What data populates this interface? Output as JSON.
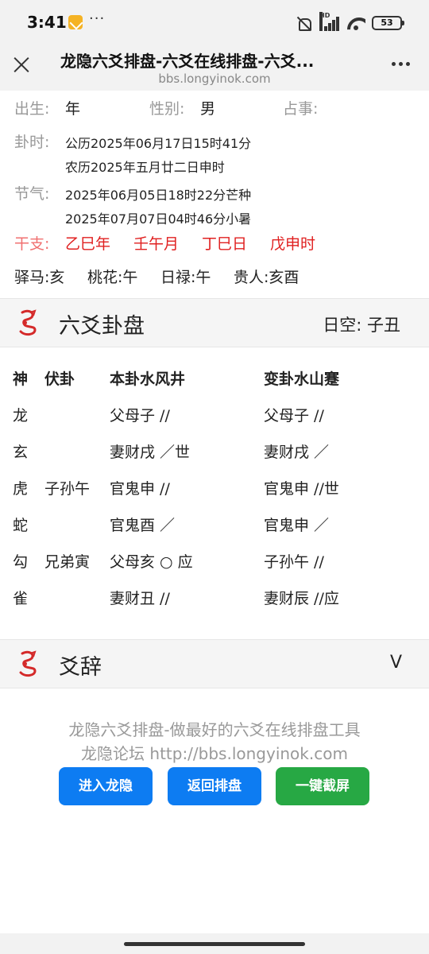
{
  "status": {
    "time": "3:41",
    "dots": "···",
    "hd": "HD",
    "battery": "53"
  },
  "header": {
    "title": "龙隐六爻排盘-六爻在线排盘-六爻...",
    "url": "bbs.longyinok.com"
  },
  "info": {
    "birth_label": "出生:",
    "birth_value": "年",
    "gender_label": "性别:",
    "gender_value": "男",
    "matter_label": "占事:",
    "time_label": "卦时:",
    "time_solar": "公历2025年06月17日15时41分",
    "time_lunar": "农历2025年五月廿二日申时",
    "jieqi_label": "节气:",
    "jieqi_1": "2025年06月05日18时22分芒种",
    "jieqi_2": "2025年07月07日04时46分小暑",
    "ganzhi_label": "干支:",
    "ganzhi": [
      "乙巳年",
      "壬午月",
      "丁巳日",
      "戊申时"
    ],
    "shensha": [
      "驿马:亥",
      "桃花:午",
      "日禄:午",
      "贵人:亥酉"
    ]
  },
  "section_gua": {
    "title": "六爻卦盘",
    "kong": "日空:  子丑"
  },
  "table": {
    "headers": [
      "神",
      "伏卦",
      "本卦水风井",
      "变卦水山蹇"
    ],
    "rows": [
      [
        "龙",
        "",
        "父母子 //",
        "父母子 //"
      ],
      [
        "玄",
        "",
        "妻财戌 ／世",
        "妻财戌 ／"
      ],
      [
        "虎",
        "子孙午",
        "官鬼申 //",
        "官鬼申 //世"
      ],
      [
        "蛇",
        "",
        "官鬼酉 ／",
        "官鬼申 ／"
      ],
      [
        "勾",
        "兄弟寅",
        "父母亥 ○ 应",
        "子孙午 //"
      ],
      [
        "雀",
        "",
        "妻财丑 //",
        "妻财辰 //应"
      ]
    ]
  },
  "section_yaoci": {
    "title": "爻辞",
    "chevron": "V"
  },
  "footer": {
    "line1": "龙隐六爻排盘-做最好的六爻在线排盘工具",
    "line2": "龙隐论坛 http://bbs.longyinok.com",
    "btn_enter": "进入龙隐",
    "btn_back": "返回排盘",
    "btn_screenshot": "一键截屏"
  },
  "colors": {
    "red": "#e02020",
    "blue_button": "#0d7cf2",
    "green_button": "#27a844"
  }
}
